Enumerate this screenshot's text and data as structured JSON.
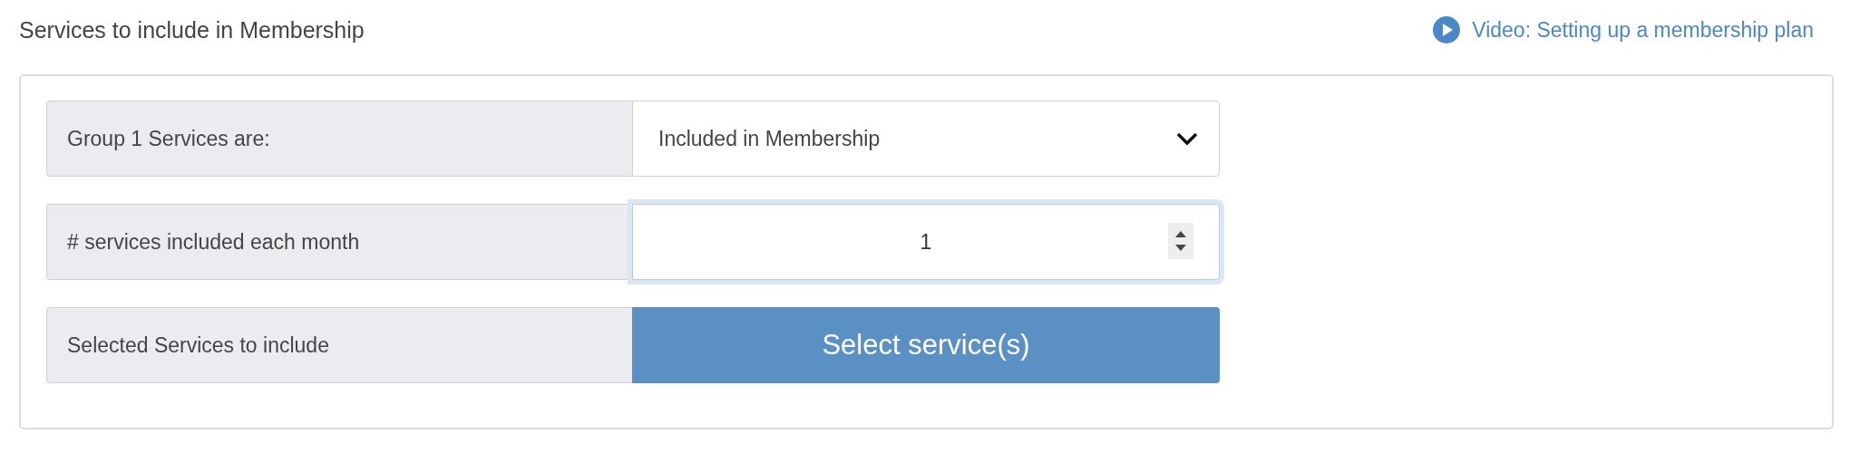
{
  "header": {
    "title": "Services to include in Membership",
    "video_link": "Video: Setting up a membership plan"
  },
  "rows": [
    {
      "kind": "select",
      "label": "Group 1 Services are:",
      "value": "Included in Membership"
    },
    {
      "kind": "number",
      "label": "# services included each month",
      "value": "1",
      "focused": true
    },
    {
      "kind": "button",
      "label": "Selected Services to include",
      "button": "Select service(s)"
    }
  ]
}
